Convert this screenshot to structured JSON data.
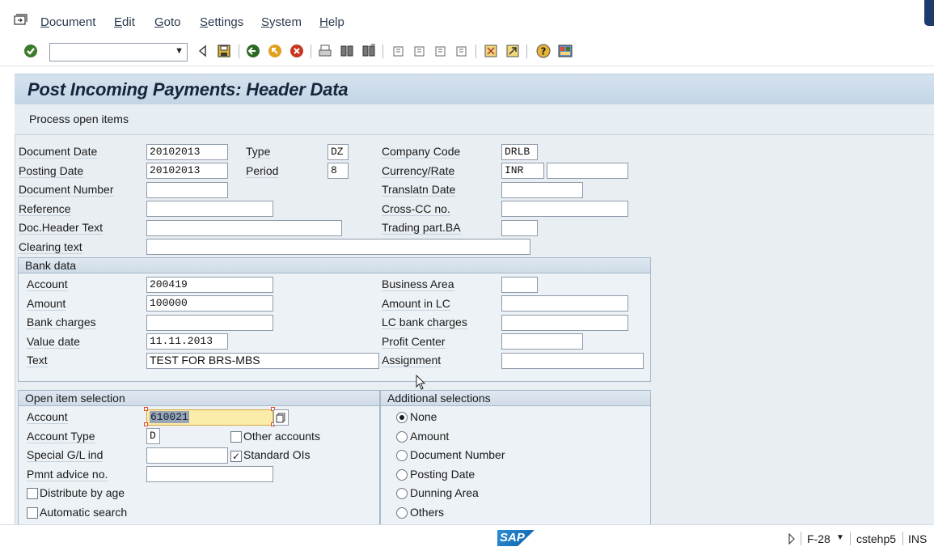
{
  "menu": {
    "items": [
      "Document",
      "Edit",
      "Goto",
      "Settings",
      "System",
      "Help"
    ]
  },
  "toolbar": {
    "command_value": "",
    "icons": [
      "enter-icon",
      "back-arrow-icon",
      "save-icon",
      "back-icon",
      "exit-icon",
      "cancel-icon",
      "print-icon",
      "find-icon",
      "find-next-icon",
      "first-page-icon",
      "previous-page-icon",
      "next-page-icon",
      "last-page-icon",
      "create-session-icon",
      "shortcut-icon",
      "help-icon",
      "customize-layout-icon"
    ]
  },
  "title": "Post Incoming Payments: Header Data",
  "app_toolbar": {
    "process_open_items": "Process open items"
  },
  "header": {
    "document_date_label": "Document Date",
    "document_date": "20102013",
    "type_label": "Type",
    "type": "DZ",
    "company_code_label": "Company Code",
    "company_code": "DRLB",
    "posting_date_label": "Posting Date",
    "posting_date": "20102013",
    "period_label": "Period",
    "period": "8",
    "currency_rate_label": "Currency/Rate",
    "currency": "INR",
    "rate": "",
    "document_number_label": "Document Number",
    "document_number": "",
    "translatn_date_label": "Translatn Date",
    "translatn_date": "",
    "reference_label": "Reference",
    "reference": "",
    "cross_cc_label": "Cross-CC no.",
    "cross_cc": "",
    "doc_header_text_label": "Doc.Header Text",
    "doc_header_text": "",
    "trading_part_label": "Trading part.BA",
    "trading_part": "",
    "clearing_text_label": "Clearing text",
    "clearing_text": ""
  },
  "bank_data": {
    "title": "Bank data",
    "account_label": "Account",
    "account": "200419",
    "business_area_label": "Business Area",
    "business_area": "",
    "amount_label": "Amount",
    "amount": "100000",
    "amount_lc_label": "Amount in LC",
    "amount_lc": "",
    "bank_charges_label": "Bank charges",
    "bank_charges": "",
    "lc_bank_charges_label": "LC bank charges",
    "lc_bank_charges": "",
    "value_date_label": "Value date",
    "value_date": "11.11.2013",
    "profit_center_label": "Profit Center",
    "profit_center": "",
    "text_label": "Text",
    "text": "TEST FOR BRS-MBS",
    "assignment_label": "Assignment",
    "assignment": ""
  },
  "open_item_selection": {
    "title": "Open item selection",
    "account_label": "Account",
    "account": "610021",
    "account_type_label": "Account Type",
    "account_type": "D",
    "other_accounts_label": "Other accounts",
    "other_accounts_checked": false,
    "special_gl_label": "Special G/L ind",
    "special_gl": "",
    "standard_ois_label": "Standard OIs",
    "standard_ois_checked": true,
    "pmnt_advice_label": "Pmnt advice no.",
    "pmnt_advice": "",
    "distribute_by_age_label": "Distribute by age",
    "distribute_by_age_checked": false,
    "automatic_search_label": "Automatic search",
    "automatic_search_checked": false
  },
  "additional_selections": {
    "title": "Additional selections",
    "options": [
      "None",
      "Amount",
      "Document Number",
      "Posting Date",
      "Dunning Area",
      "Others"
    ],
    "selected": "None"
  },
  "status_bar": {
    "transaction": "F-28",
    "server": "cstehp5",
    "mode": "INS",
    "logo": "SAP"
  }
}
